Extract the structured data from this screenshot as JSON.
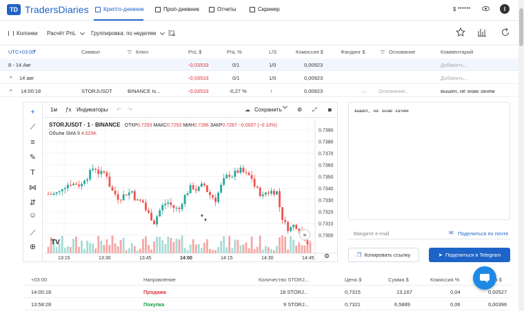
{
  "app": {
    "logo_mark": "TD",
    "name": "TradersDiaries"
  },
  "nav": {
    "items": [
      {
        "label": "Крипто-дневник",
        "icon": "crypto-diary-icon"
      },
      {
        "label": "Проп-дневник",
        "icon": "prop-diary-icon"
      },
      {
        "label": "Отчеты",
        "icon": "reports-icon"
      },
      {
        "label": "Скринер",
        "icon": "screener-icon"
      }
    ],
    "balance": "$ ******",
    "avatar": "I"
  },
  "toolbar": {
    "columns": "Колонки",
    "pnl_calc": "Расчёт PnL",
    "grouping": "Группировка: по неделям"
  },
  "table": {
    "headers": [
      "UTC+03:00",
      "Символ",
      "Ключ",
      "PnL $",
      "PnL %",
      "L/S",
      "Комиссия $",
      "Фандинг $",
      "Основание",
      "Комментарий"
    ],
    "group_row": {
      "label": "8 - 14 Авг",
      "pnl": "-0,03533",
      "pnl_pct": "0/1",
      "ls": "1/0",
      "fee": "0,00923",
      "comment_ph": "Добавить..."
    },
    "day_row": {
      "label": "14 авг",
      "pnl": "-0,03533",
      "pnl_pct": "0/1",
      "ls": "1/0",
      "fee": "0,00923",
      "comment_ph": "Добавить..."
    },
    "trade_row": {
      "time": "14:00:18",
      "symbol": "STORJUSDT",
      "key": "BINANCE Is...",
      "pnl": "-0,03533",
      "pnl_pct": "-0,27 %",
      "ls": "↑",
      "fee": "0,00923",
      "funding": "—",
      "basis_ph": "Основание...",
      "comment": "вышел, не знаю зачем"
    }
  },
  "chart": {
    "interval": "1м",
    "indicators": "Индикаторы",
    "save": "Сохранить",
    "symbol": "STORJUSDT · 1 · BINANCE",
    "ohlc": {
      "o_label": "ОТКР",
      "o": "0.7293",
      "h_label": "МАКС",
      "h": "0.7293",
      "l_label": "МИН",
      "l": "0.7286",
      "c_label": "ЗАКР",
      "c": "0.7287",
      "chg": "−0.0007 (−0.10%)"
    },
    "volume_label": "Объём SMA 9",
    "volume_value": "4.025K",
    "time_labels": [
      "13:15",
      "13:30",
      "13:45",
      "14:00",
      "14:15",
      "14:30",
      "14:45"
    ]
  },
  "chart_data": {
    "type": "candlestick",
    "ylim": [
      0.7295,
      0.7395
    ],
    "y_ticks": [
      "0.7390",
      "0.7380",
      "0.7370",
      "0.7360",
      "0.7350",
      "0.7340",
      "0.7330",
      "0.7320",
      "0.7310",
      "0.7300"
    ]
  },
  "comment_box": {
    "text": "вышел, не знаю зачем"
  },
  "share": {
    "email_placeholder": "Введите e-mail",
    "share_mail": "Поделиться по почте",
    "copy_link": "Копировать ссылку",
    "telegram": "Поделиться в Telegram"
  },
  "trades": {
    "headers": [
      "+03:00",
      "Направление",
      "Количество STORJ...",
      "Цена $",
      "Сумма $",
      "Комиссия %",
      "Комиссия $"
    ],
    "rows": [
      {
        "time": "14:00:18",
        "side": "Продажа",
        "qty": "18 STORJ...",
        "price": "0,7315",
        "sum": "13,167",
        "fee_pct": "0,04",
        "fee": "0,00527"
      },
      {
        "time": "13:58:28",
        "side": "Покупка",
        "qty": "9 STORJ...",
        "price": "0,7321",
        "sum": "6,5889",
        "fee_pct": "0,06",
        "fee": "0,00396"
      }
    ]
  }
}
